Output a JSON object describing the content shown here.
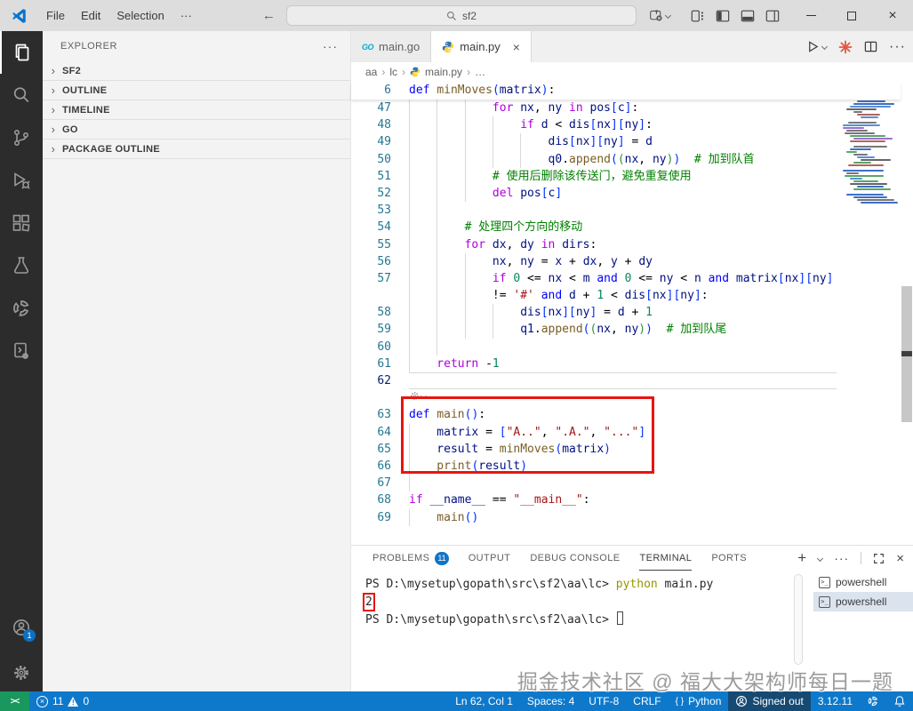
{
  "window": {
    "menus": [
      "File",
      "Edit",
      "Selection",
      "···"
    ],
    "back_arrow": "←",
    "forward_arrow": "→",
    "search_value": "sf2"
  },
  "sidebar": {
    "header": "EXPLORER",
    "more": "···",
    "sections": [
      "SF2",
      "OUTLINE",
      "TIMELINE",
      "GO",
      "PACKAGE OUTLINE"
    ]
  },
  "editor": {
    "tabs": [
      {
        "label": "main.go",
        "icon": "go",
        "logo_text": "GO"
      },
      {
        "label": "main.py",
        "icon": "python",
        "active": true,
        "close": "×"
      }
    ],
    "breadcrumb": [
      "aa",
      "lc",
      "main.py",
      "…"
    ],
    "sticky": {
      "num": "6",
      "tokens": [
        [
          "kb",
          "def"
        ],
        [
          "p",
          " "
        ],
        [
          "fn",
          "minMoves"
        ],
        [
          "b1",
          "("
        ],
        [
          "v",
          "matrix"
        ],
        [
          "b1",
          ")"
        ],
        [
          "p",
          ":"
        ]
      ]
    },
    "lines": [
      {
        "n": "47",
        "i": 12,
        "t": [
          [
            "k",
            "for"
          ],
          [
            "p",
            " "
          ],
          [
            "v",
            "nx"
          ],
          [
            "p",
            ", "
          ],
          [
            "v",
            "ny"
          ],
          [
            "p",
            " "
          ],
          [
            "k",
            "in"
          ],
          [
            "p",
            " "
          ],
          [
            "v",
            "pos"
          ],
          [
            "b1",
            "["
          ],
          [
            "v",
            "c"
          ],
          [
            "b1",
            "]"
          ],
          [
            "p",
            ":"
          ]
        ]
      },
      {
        "n": "48",
        "i": 16,
        "t": [
          [
            "k",
            "if"
          ],
          [
            "p",
            " "
          ],
          [
            "v",
            "d"
          ],
          [
            "p",
            " < "
          ],
          [
            "v",
            "dis"
          ],
          [
            "b1",
            "["
          ],
          [
            "v",
            "nx"
          ],
          [
            "b1",
            "]"
          ],
          [
            "b1",
            "["
          ],
          [
            "v",
            "ny"
          ],
          [
            "b1",
            "]"
          ],
          [
            "p",
            ":"
          ]
        ]
      },
      {
        "n": "49",
        "i": 20,
        "t": [
          [
            "v",
            "dis"
          ],
          [
            "b1",
            "["
          ],
          [
            "v",
            "nx"
          ],
          [
            "b1",
            "]"
          ],
          [
            "b1",
            "["
          ],
          [
            "v",
            "ny"
          ],
          [
            "b1",
            "]"
          ],
          [
            "p",
            " = "
          ],
          [
            "v",
            "d"
          ]
        ]
      },
      {
        "n": "50",
        "i": 20,
        "t": [
          [
            "v",
            "q0"
          ],
          [
            "p",
            "."
          ],
          [
            "fn",
            "append"
          ],
          [
            "b1",
            "("
          ],
          [
            "b2",
            "("
          ],
          [
            "v",
            "nx"
          ],
          [
            "p",
            ", "
          ],
          [
            "v",
            "ny"
          ],
          [
            "b2",
            ")"
          ],
          [
            "b1",
            ")"
          ],
          [
            "p",
            "  "
          ],
          [
            "c",
            "# 加到队首"
          ]
        ]
      },
      {
        "n": "51",
        "i": 12,
        "t": [
          [
            "c",
            "# 使用后删除该传送门，避免重复使用"
          ]
        ]
      },
      {
        "n": "52",
        "i": 12,
        "t": [
          [
            "k",
            "del"
          ],
          [
            "p",
            " "
          ],
          [
            "v",
            "pos"
          ],
          [
            "b1",
            "["
          ],
          [
            "v",
            "c"
          ],
          [
            "b1",
            "]"
          ]
        ]
      },
      {
        "n": "53",
        "i": 0,
        "g": 2,
        "t": []
      },
      {
        "n": "54",
        "i": 8,
        "t": [
          [
            "c",
            "# 处理四个方向的移动"
          ]
        ]
      },
      {
        "n": "55",
        "i": 8,
        "t": [
          [
            "k",
            "for"
          ],
          [
            "p",
            " "
          ],
          [
            "v",
            "dx"
          ],
          [
            "p",
            ", "
          ],
          [
            "v",
            "dy"
          ],
          [
            "p",
            " "
          ],
          [
            "k",
            "in"
          ],
          [
            "p",
            " "
          ],
          [
            "v",
            "dirs"
          ],
          [
            "p",
            ":"
          ]
        ]
      },
      {
        "n": "56",
        "i": 12,
        "t": [
          [
            "v",
            "nx"
          ],
          [
            "p",
            ", "
          ],
          [
            "v",
            "ny"
          ],
          [
            "p",
            " = "
          ],
          [
            "v",
            "x"
          ],
          [
            "p",
            " + "
          ],
          [
            "v",
            "dx"
          ],
          [
            "p",
            ", "
          ],
          [
            "v",
            "y"
          ],
          [
            "p",
            " + "
          ],
          [
            "v",
            "dy"
          ]
        ]
      },
      {
        "n": "57",
        "i": 12,
        "t": [
          [
            "k",
            "if"
          ],
          [
            "p",
            " "
          ],
          [
            "n",
            "0"
          ],
          [
            "p",
            " <= "
          ],
          [
            "v",
            "nx"
          ],
          [
            "p",
            " < "
          ],
          [
            "v",
            "m"
          ],
          [
            "p",
            " "
          ],
          [
            "kb",
            "and"
          ],
          [
            "p",
            " "
          ],
          [
            "n",
            "0"
          ],
          [
            "p",
            " <= "
          ],
          [
            "v",
            "ny"
          ],
          [
            "p",
            " < "
          ],
          [
            "v",
            "n"
          ],
          [
            "p",
            " "
          ],
          [
            "kb",
            "and"
          ],
          [
            "p",
            " "
          ],
          [
            "v",
            "matrix"
          ],
          [
            "b1",
            "["
          ],
          [
            "v",
            "nx"
          ],
          [
            "b1",
            "]"
          ],
          [
            "b1",
            "["
          ],
          [
            "v",
            "ny"
          ],
          [
            "b1",
            "]"
          ]
        ]
      },
      {
        "wrap": true,
        "i": 12,
        "t": [
          [
            "p",
            "!= "
          ],
          [
            "s",
            "'#'"
          ],
          [
            "p",
            " "
          ],
          [
            "kb",
            "and"
          ],
          [
            "p",
            " "
          ],
          [
            "v",
            "d"
          ],
          [
            "p",
            " + "
          ],
          [
            "n",
            "1"
          ],
          [
            "p",
            " < "
          ],
          [
            "v",
            "dis"
          ],
          [
            "b1",
            "["
          ],
          [
            "v",
            "nx"
          ],
          [
            "b1",
            "]"
          ],
          [
            "b1",
            "["
          ],
          [
            "v",
            "ny"
          ],
          [
            "b1",
            "]"
          ],
          [
            "p",
            ":"
          ]
        ]
      },
      {
        "n": "58",
        "i": 16,
        "t": [
          [
            "v",
            "dis"
          ],
          [
            "b1",
            "["
          ],
          [
            "v",
            "nx"
          ],
          [
            "b1",
            "]"
          ],
          [
            "b1",
            "["
          ],
          [
            "v",
            "ny"
          ],
          [
            "b1",
            "]"
          ],
          [
            "p",
            " = "
          ],
          [
            "v",
            "d"
          ],
          [
            "p",
            " + "
          ],
          [
            "n",
            "1"
          ]
        ]
      },
      {
        "n": "59",
        "i": 16,
        "t": [
          [
            "v",
            "q1"
          ],
          [
            "p",
            "."
          ],
          [
            "fn",
            "append"
          ],
          [
            "b1",
            "("
          ],
          [
            "b2",
            "("
          ],
          [
            "v",
            "nx"
          ],
          [
            "p",
            ", "
          ],
          [
            "v",
            "ny"
          ],
          [
            "b2",
            ")"
          ],
          [
            "b1",
            ")"
          ],
          [
            "p",
            "  "
          ],
          [
            "c",
            "# 加到队尾"
          ]
        ]
      },
      {
        "n": "60",
        "i": 0,
        "g": 2,
        "t": []
      },
      {
        "n": "61",
        "i": 4,
        "t": [
          [
            "k",
            "return"
          ],
          [
            "p",
            " -"
          ],
          [
            "n",
            "1"
          ]
        ]
      },
      {
        "n": "62",
        "i": 0,
        "g": 0,
        "cur": true,
        "t": []
      },
      {
        "type": "icon"
      },
      {
        "n": "63",
        "i": 0,
        "t": [
          [
            "kb",
            "def"
          ],
          [
            "p",
            " "
          ],
          [
            "fn",
            "main"
          ],
          [
            "b1",
            "("
          ],
          [
            "b1",
            ")"
          ],
          [
            "p",
            ":"
          ]
        ]
      },
      {
        "n": "64",
        "i": 4,
        "t": [
          [
            "v",
            "matrix"
          ],
          [
            "p",
            " = "
          ],
          [
            "b1",
            "["
          ],
          [
            "s",
            "\"A..\""
          ],
          [
            "p",
            ", "
          ],
          [
            "s",
            "\".A.\""
          ],
          [
            "p",
            ", "
          ],
          [
            "s",
            "\"...\""
          ],
          [
            "b1",
            "]"
          ]
        ]
      },
      {
        "n": "65",
        "i": 4,
        "t": [
          [
            "v",
            "result"
          ],
          [
            "p",
            " = "
          ],
          [
            "fn",
            "minMoves"
          ],
          [
            "b1",
            "("
          ],
          [
            "v",
            "matrix"
          ],
          [
            "b1",
            ")"
          ]
        ]
      },
      {
        "n": "66",
        "i": 4,
        "t": [
          [
            "fn",
            "print"
          ],
          [
            "b1",
            "("
          ],
          [
            "v",
            "result"
          ],
          [
            "b1",
            ")"
          ]
        ]
      },
      {
        "n": "67",
        "i": 0,
        "g": 1,
        "t": []
      },
      {
        "n": "68",
        "i": 0,
        "t": [
          [
            "k",
            "if"
          ],
          [
            "p",
            " "
          ],
          [
            "v",
            "__name__"
          ],
          [
            "p",
            " == "
          ],
          [
            "s",
            "\"__main__\""
          ],
          [
            "p",
            ":"
          ]
        ]
      },
      {
        "n": "69",
        "i": 4,
        "t": [
          [
            "fn",
            "main"
          ],
          [
            "b1",
            "("
          ],
          [
            "b1",
            ")"
          ]
        ]
      }
    ]
  },
  "panel": {
    "tabs": [
      {
        "label": "PROBLEMS",
        "badge": "11"
      },
      {
        "label": "OUTPUT"
      },
      {
        "label": "DEBUG CONSOLE"
      },
      {
        "label": "TERMINAL",
        "active": true
      },
      {
        "label": "PORTS"
      }
    ],
    "terminal": [
      {
        "segs": [
          [
            "p",
            "PS D:\\mysetup\\gopath\\src\\sf2\\aa\\lc> "
          ],
          [
            "cmd",
            "python"
          ],
          [
            "p",
            " main.py"
          ]
        ]
      },
      {
        "segs": [
          [
            "boxed",
            "2"
          ]
        ]
      },
      {
        "segs": [
          [
            "p",
            "PS D:\\mysetup\\gopath\\src\\sf2\\aa\\lc> "
          ],
          [
            "cursor",
            ""
          ]
        ]
      }
    ],
    "terminal_tabs": [
      {
        "label": "powershell"
      },
      {
        "label": "powershell",
        "selected": true
      }
    ]
  },
  "status": {
    "errors": "11",
    "warnings": "0",
    "line_col": "Ln 62, Col 1",
    "spaces": "Spaces: 4",
    "encoding": "UTF-8",
    "eol": "CRLF",
    "language": "Python",
    "language_glyph": "{ }",
    "account": "Signed out",
    "python_version": "3.12.11",
    "remote_glyph": "><"
  },
  "watermark": "掘金技术社区 @ 福大大架构师每日一题",
  "colors": {
    "status_bar": "#0e79cb",
    "remote": "#19975d",
    "annotation_red": "#e8140f",
    "activity_bar": "#2c2c2c",
    "badge_blue": "#1273c8"
  }
}
